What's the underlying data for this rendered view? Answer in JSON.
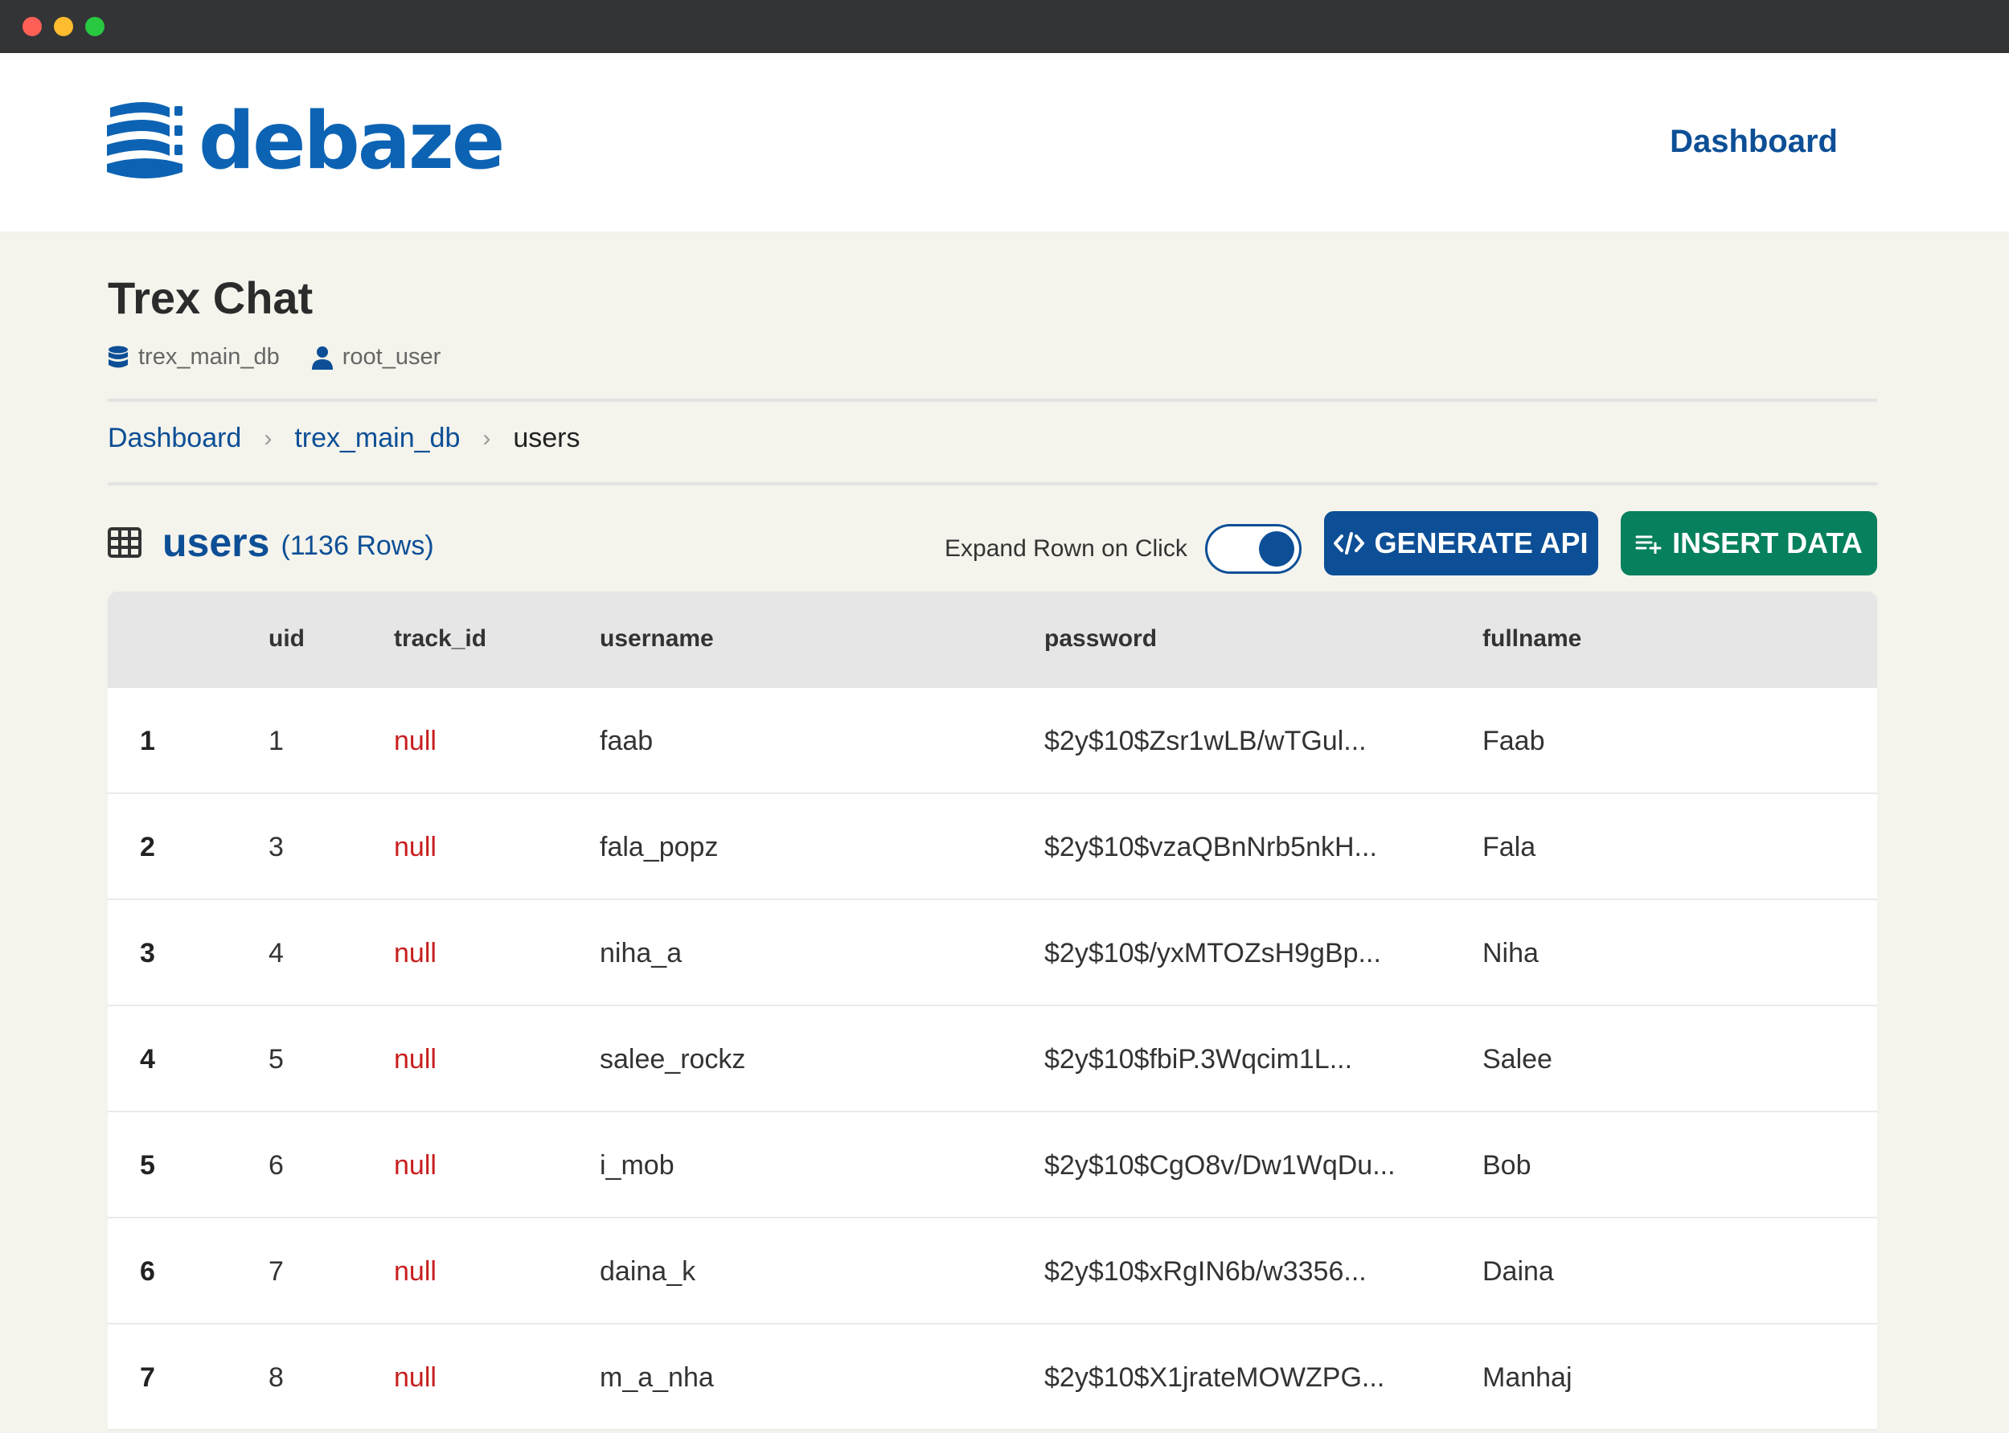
{
  "window": {
    "controls": [
      "close",
      "minimize",
      "maximize"
    ]
  },
  "brand": {
    "name": "debaze",
    "icon": "database-stack-icon",
    "color": "#0d63b3"
  },
  "nav": {
    "dashboard_label": "Dashboard"
  },
  "project": {
    "title": "Trex Chat",
    "database": "trex_main_db",
    "user": "root_user"
  },
  "breadcrumb": {
    "items": [
      "Dashboard",
      "trex_main_db"
    ],
    "current": "users"
  },
  "table_info": {
    "name": "users",
    "count_label": "(1136 Rows)"
  },
  "toggle": {
    "label": "Expand Rown on Click",
    "enabled": true
  },
  "buttons": {
    "generate_api": "GENERATE API",
    "insert_data": "INSERT DATA"
  },
  "colors": {
    "primary": "#0d4f96",
    "success": "#06805d",
    "null": "#c81e1e"
  },
  "columns": [
    "",
    "uid",
    "track_id",
    "username",
    "password",
    "fullname"
  ],
  "rows": [
    {
      "idx": "1",
      "uid": "1",
      "track_id": "null",
      "username": "faab",
      "password": "$2y$10$Zsr1wLB/wTGul...",
      "fullname": "Faab"
    },
    {
      "idx": "2",
      "uid": "3",
      "track_id": "null",
      "username": "fala_popz",
      "password": "$2y$10$vzaQBnNrb5nkH...",
      "fullname": "Fala"
    },
    {
      "idx": "3",
      "uid": "4",
      "track_id": "null",
      "username": "niha_a",
      "password": "$2y$10$/yxMTOZsH9gBp...",
      "fullname": "Niha"
    },
    {
      "idx": "4",
      "uid": "5",
      "track_id": "null",
      "username": "salee_rockz",
      "password": "$2y$10$fbiP.3Wqcim1L...",
      "fullname": "Salee"
    },
    {
      "idx": "5",
      "uid": "6",
      "track_id": "null",
      "username": "i_mob",
      "password": "$2y$10$CgO8v/Dw1WqDu...",
      "fullname": "Bob"
    },
    {
      "idx": "6",
      "uid": "7",
      "track_id": "null",
      "username": "daina_k",
      "password": "$2y$10$xRgIN6b/w3356...",
      "fullname": "Daina"
    },
    {
      "idx": "7",
      "uid": "8",
      "track_id": "null",
      "username": "m_a_nha",
      "password": "$2y$10$X1jrateMOWZPG...",
      "fullname": "Manhaj"
    }
  ]
}
